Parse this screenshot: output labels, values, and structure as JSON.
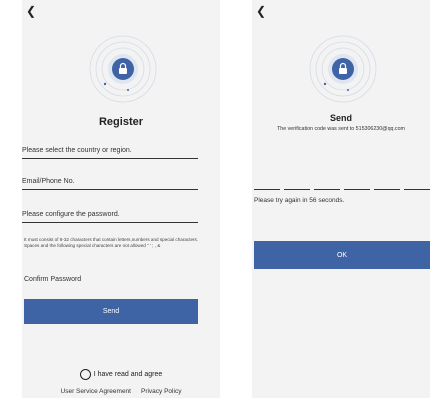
{
  "register": {
    "back_icon": "chevron-left-icon",
    "title": "Register",
    "country_placeholder": "Please select the country or region.",
    "email_placeholder": "Email/Phone No.",
    "password_placeholder": "Please configure the password.",
    "password_hint": "It must consist of 8-32 characters that contain letters,numbers and special characters. Spaces and the following special characters are not allowed \" ' ; , &",
    "confirm_password_placeholder": "Confirm Password",
    "send_label": "Send",
    "agree_label": "I have read and agree",
    "user_agreement_link": "User Service Agreement",
    "privacy_link": "Privacy Policy"
  },
  "send": {
    "back_icon": "chevron-left-icon",
    "title": "Send",
    "sent_message": "The verification code was sent to 515306230@qq.com",
    "retry_message": "Please try again in 56 seconds.",
    "ok_label": "OK",
    "code_digits": [
      "",
      "",
      "",
      "",
      "",
      ""
    ]
  },
  "colors": {
    "accent": "#3f64a6",
    "ring": "#c7d2e6",
    "background": "#f3f3f3"
  }
}
